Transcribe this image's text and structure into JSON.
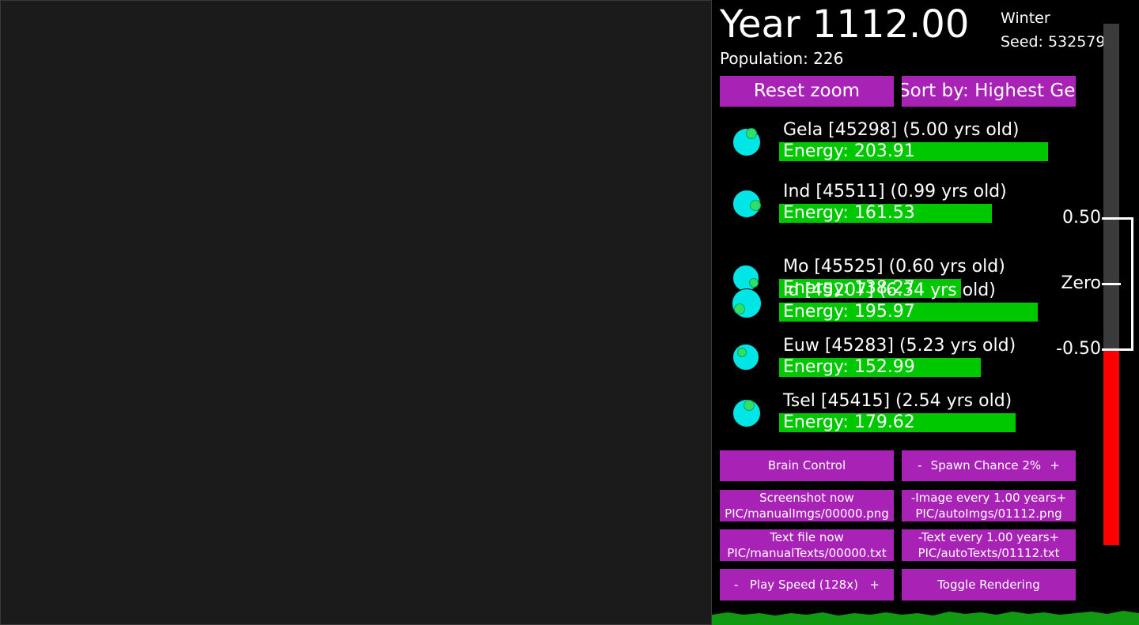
{
  "hud": {
    "year": "Year 1112.00",
    "season": "Winter",
    "seed": "Seed: 532579",
    "population": "Population: 226"
  },
  "buttons": {
    "reset_zoom": "Reset zoom",
    "sort_by": "Sort by: Highest Gen",
    "brain_control": "Brain Control",
    "spawn_minus": "-",
    "spawn_label": "Spawn Chance 2%",
    "spawn_plus": "+",
    "screenshot_now": "Screenshot now",
    "screenshot_path": "PIC/manualImgs/00000.png",
    "image_minus": "-",
    "image_every": "Image every 1.00 years",
    "image_plus": "+",
    "image_path": "PIC/autoImgs/01112.png",
    "textfile_now": "Text file now",
    "textfile_path": "PIC/manualTexts/00000.txt",
    "text_minus": "-",
    "text_every": "Text every 1.00 years",
    "text_plus": "+",
    "text_path": "PIC/autoTexts/01112.txt",
    "speed_minus": "-",
    "speed_label": "Play Speed (128x)",
    "speed_plus": "+",
    "toggle_rendering": "Toggle Rendering"
  },
  "creatures": [
    {
      "name": "Gela [45298] (5.00 yrs old)",
      "energy": "Energy: 203.91",
      "energy_value": 203.91
    },
    {
      "name": "Ind [45511] (0.99 yrs old)",
      "energy": "Energy: 161.53",
      "energy_value": 161.53
    },
    {
      "name": "Mo [45525] (0.60 yrs old)",
      "energy": "Energy: 138.27",
      "energy_value": 138.27
    },
    {
      "name": "Id [45207] (6.34 yrs old)",
      "energy": "Energy: 195.97",
      "energy_value": 195.97
    },
    {
      "name": "Euw [45283] (5.23 yrs old)",
      "energy": "Energy: 152.99",
      "energy_value": 152.99
    },
    {
      "name": "Tsel [45415] (2.54 yrs old)",
      "energy": "Energy: 179.62",
      "energy_value": 179.62
    }
  ],
  "scale": {
    "top_label": "0.50",
    "mid_label": "Zero",
    "bottom_label": "-0.50"
  },
  "colors": {
    "button": "#a722b5",
    "orb": "#00e5e5",
    "energy": "#00c800",
    "scale_negative": "#ff0000"
  }
}
